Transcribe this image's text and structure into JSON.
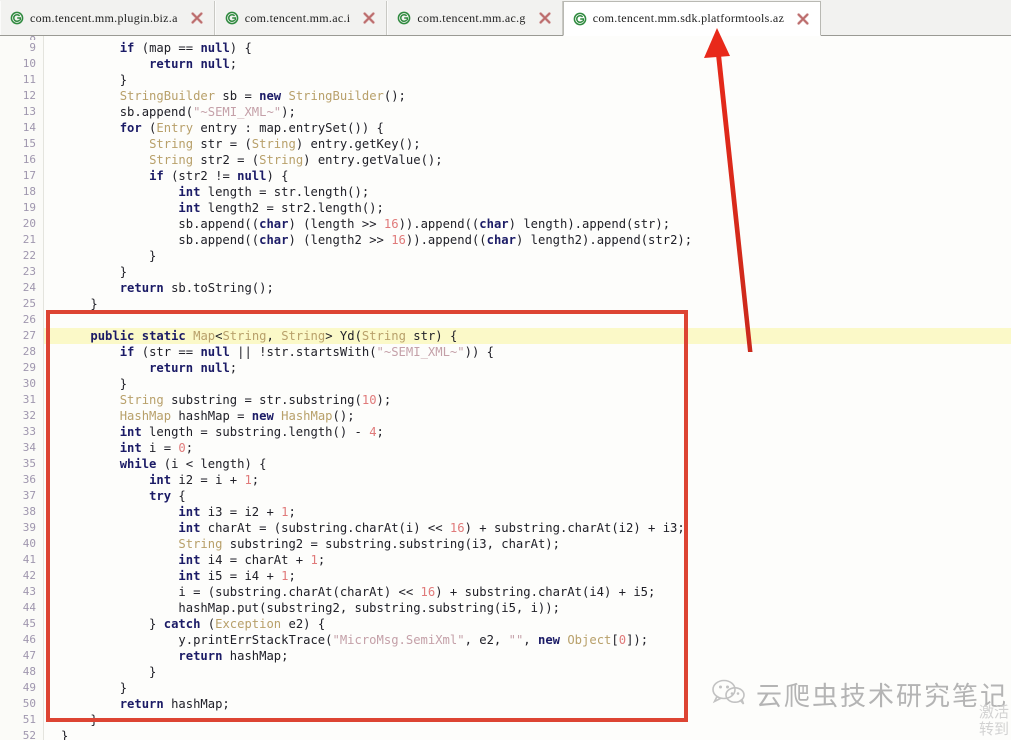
{
  "window": {
    "type": "java-decompiler-editor"
  },
  "tabs": [
    {
      "label": "com.tencent.mm.plugin.biz.a",
      "icon": "java-class-icon",
      "close_icon": "close-x-icon",
      "active": false
    },
    {
      "label": "com.tencent.mm.ac.i",
      "icon": "java-class-icon",
      "close_icon": "close-x-icon",
      "active": false
    },
    {
      "label": "com.tencent.mm.ac.g",
      "icon": "java-class-icon",
      "close_icon": "close-x-icon",
      "active": false
    },
    {
      "label": "com.tencent.mm.sdk.platformtools.az",
      "icon": "java-class-icon",
      "close_icon": "close-x-icon",
      "active": true
    }
  ],
  "editor": {
    "first_line_number": 9,
    "highlighted_line": 27,
    "gutter_start": 8,
    "lines": [
      {
        "n": 9,
        "text": "        if (map == null) {"
      },
      {
        "n": 10,
        "text": "            return null;"
      },
      {
        "n": 11,
        "text": "        }"
      },
      {
        "n": 12,
        "text": "        StringBuilder sb = new StringBuilder();"
      },
      {
        "n": 13,
        "text": "        sb.append(\"~SEMI_XML~\");"
      },
      {
        "n": 14,
        "text": "        for (Entry entry : map.entrySet()) {"
      },
      {
        "n": 15,
        "text": "            String str = (String) entry.getKey();"
      },
      {
        "n": 16,
        "text": "            String str2 = (String) entry.getValue();"
      },
      {
        "n": 17,
        "text": "            if (str2 != null) {"
      },
      {
        "n": 18,
        "text": "                int length = str.length();"
      },
      {
        "n": 19,
        "text": "                int length2 = str2.length();"
      },
      {
        "n": 20,
        "text": "                sb.append((char) (length >> 16)).append((char) length).append(str);"
      },
      {
        "n": 21,
        "text": "                sb.append((char) (length2 >> 16)).append((char) length2).append(str2);"
      },
      {
        "n": 22,
        "text": "            }"
      },
      {
        "n": 23,
        "text": "        }"
      },
      {
        "n": 24,
        "text": "        return sb.toString();"
      },
      {
        "n": 25,
        "text": "    }"
      },
      {
        "n": 26,
        "text": ""
      },
      {
        "n": 27,
        "text": "    public static Map<String, String> Yd(String str) {"
      },
      {
        "n": 28,
        "text": "        if (str == null || !str.startsWith(\"~SEMI_XML~\")) {"
      },
      {
        "n": 29,
        "text": "            return null;"
      },
      {
        "n": 30,
        "text": "        }"
      },
      {
        "n": 31,
        "text": "        String substring = str.substring(10);"
      },
      {
        "n": 32,
        "text": "        HashMap hashMap = new HashMap();"
      },
      {
        "n": 33,
        "text": "        int length = substring.length() - 4;"
      },
      {
        "n": 34,
        "text": "        int i = 0;"
      },
      {
        "n": 35,
        "text": "        while (i < length) {"
      },
      {
        "n": 36,
        "text": "            int i2 = i + 1;"
      },
      {
        "n": 37,
        "text": "            try {"
      },
      {
        "n": 38,
        "text": "                int i3 = i2 + 1;"
      },
      {
        "n": 39,
        "text": "                int charAt = (substring.charAt(i) << 16) + substring.charAt(i2) + i3;"
      },
      {
        "n": 40,
        "text": "                String substring2 = substring.substring(i3, charAt);"
      },
      {
        "n": 41,
        "text": "                int i4 = charAt + 1;"
      },
      {
        "n": 42,
        "text": "                int i5 = i4 + 1;"
      },
      {
        "n": 43,
        "text": "                i = (substring.charAt(charAt) << 16) + substring.charAt(i4) + i5;"
      },
      {
        "n": 44,
        "text": "                hashMap.put(substring2, substring.substring(i5, i));"
      },
      {
        "n": 45,
        "text": "            } catch (Exception e2) {"
      },
      {
        "n": 46,
        "text": "                y.printErrStackTrace(\"MicroMsg.SemiXml\", e2, \"\", new Object[0]);"
      },
      {
        "n": 47,
        "text": "                return hashMap;"
      },
      {
        "n": 48,
        "text": "            }"
      },
      {
        "n": 49,
        "text": "        }"
      },
      {
        "n": 50,
        "text": "        return hashMap;"
      },
      {
        "n": 51,
        "text": "    }"
      },
      {
        "n": 52,
        "text": "}"
      }
    ]
  },
  "annotations": {
    "red_box": {
      "name": "highlight-box",
      "color": "#dd4433"
    },
    "red_arrow": {
      "name": "pointer-arrow",
      "color": "#e02b1d",
      "points_to": "com.tencent.mm.sdk.platformtools.az"
    }
  },
  "watermark": {
    "text": "云爬虫技术研究笔记",
    "icon": "wechat-icon",
    "corner_text_line1": "激活",
    "corner_text_line2": "转到"
  },
  "colors": {
    "keyword": "#1b1b66",
    "type": "#b8a06a",
    "string": "#c4a0a8",
    "number": "#e07a7a",
    "line_number": "#9f96ae",
    "highlight_bg": "#fbf9c8",
    "annotation_red": "#dd4433",
    "tab_bar_bg": "#f2f2f0"
  }
}
